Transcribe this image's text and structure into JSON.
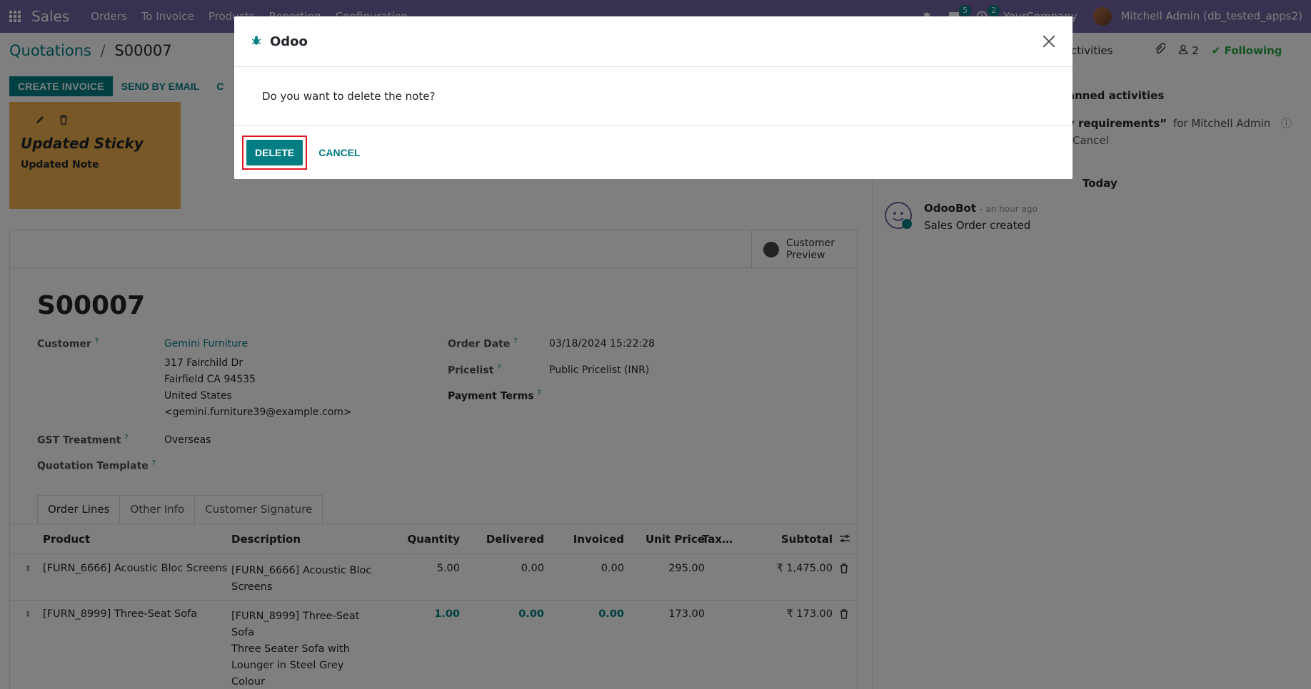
{
  "navbar": {
    "brand": "Sales",
    "menu": [
      "Orders",
      "To Invoice",
      "Products",
      "Reporting",
      "Configuration"
    ],
    "messages_count": "5",
    "activities_count": "2",
    "company": "YourCompany",
    "user": "Mitchell Admin (db_tested_apps2)"
  },
  "breadcrumb": {
    "parent": "Quotations",
    "separator": "/",
    "current": "S00007"
  },
  "actions": {
    "create_invoice": "CREATE INVOICE",
    "send_by_email": "SEND BY EMAIL",
    "more": "C"
  },
  "chatter_top": {
    "activities": "Activities",
    "followers": "2",
    "following": "Following"
  },
  "sticky": {
    "title": "Updated Sticky",
    "body": "Updated Note"
  },
  "sheet": {
    "customer_preview": "Customer Preview",
    "order_name": "S00007",
    "customer_label": "Customer",
    "customer_name": "Gemini Furniture",
    "customer_address": [
      "317 Fairchild Dr",
      "Fairfield CA 94535",
      "United States",
      "<gemini.furniture39@example.com>"
    ],
    "gst_label": "GST Treatment",
    "gst_value": "Overseas",
    "template_label": "Quotation Template",
    "order_date_label": "Order Date",
    "order_date_value": "03/18/2024 15:22:28",
    "pricelist_label": "Pricelist",
    "pricelist_value": "Public Pricelist (INR)",
    "payment_terms_label": "Payment Terms",
    "help_mark": "?"
  },
  "tabs": [
    "Order Lines",
    "Other Info",
    "Customer Signature"
  ],
  "order_lines": {
    "headers": [
      "Product",
      "Description",
      "Quantity",
      "Delivered",
      "Invoiced",
      "Unit Price",
      "Tax…",
      "Subtotal"
    ],
    "rows": [
      {
        "product": "[FURN_6666] Acoustic Bloc Screens",
        "description": [
          "[FURN_6666] Acoustic Bloc",
          "Screens"
        ],
        "quantity": "5.00",
        "delivered": "0.00",
        "invoiced": "0.00",
        "unit_price": "295.00",
        "subtotal": "₹ 1,475.00"
      },
      {
        "product": "[FURN_8999] Three-Seat Sofa",
        "description": [
          "[FURN_8999] Three-Seat",
          "Sofa",
          "Three Seater Sofa with",
          "Lounger in Steel Grey",
          "Colour"
        ],
        "quantity": "1.00",
        "delivered": "0.00",
        "invoiced": "0.00",
        "unit_price": "173.00",
        "subtotal": "₹ 173.00"
      }
    ]
  },
  "chatter": {
    "planned_activities": "anned activities",
    "activity_text": "y requirements”",
    "activity_for": "for Mitchell Admin",
    "activity_cancel": "Cancel",
    "today": "Today",
    "message_author": "OdooBot",
    "message_time": "- an hour ago",
    "message_body": "Sales Order created"
  },
  "dialog": {
    "title": "Odoo",
    "message": "Do you want to delete the note?",
    "delete_label": "DELETE",
    "cancel_label": "CANCEL"
  },
  "colors": {
    "navbar": "#71639e",
    "accent": "#017e84",
    "sticky": "#f0b04e",
    "highlight": "#e2141f"
  }
}
